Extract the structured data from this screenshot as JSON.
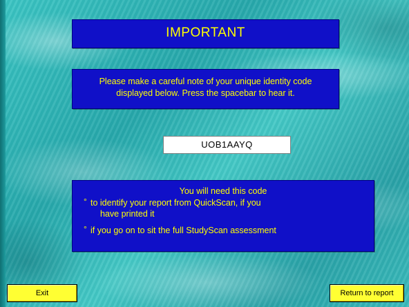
{
  "title": "IMPORTANT",
  "note": {
    "line1": "Please make a careful note of your unique identity code",
    "line2": "displayed below.  Press the spacebar to hear it."
  },
  "code": "UOB1AAYQ",
  "info": {
    "heading": "You will need this code",
    "bullet_glyph": "°",
    "bullet1_line1": "to identify your report from QuickScan, if you",
    "bullet1_line2": "have printed it",
    "bullet2": "if you go on to sit the full StudyScan assessment"
  },
  "buttons": {
    "exit": "Exit",
    "return": "Return to report"
  },
  "colors": {
    "panel": "#1010c8",
    "panel_text": "#ffff00",
    "button": "#ffff33",
    "background": "#2fb3b3"
  }
}
